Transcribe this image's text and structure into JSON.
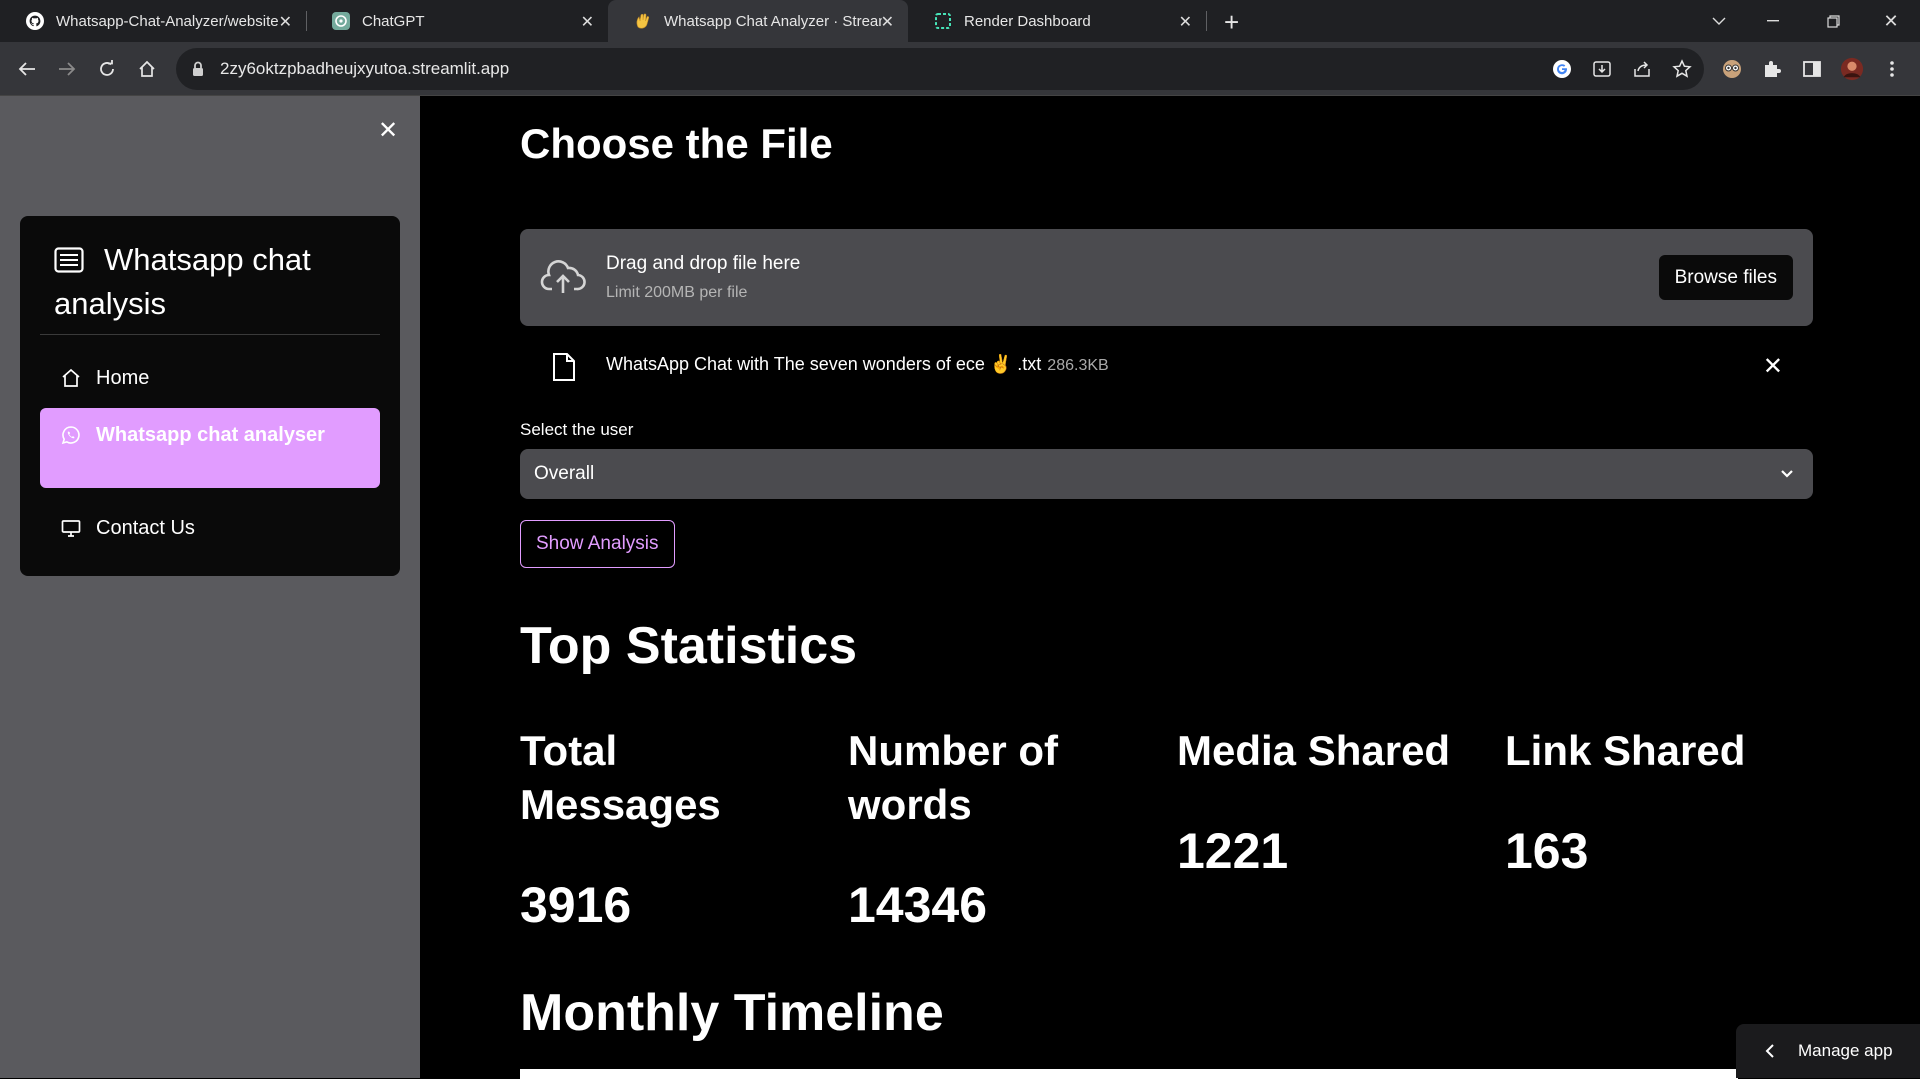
{
  "browser": {
    "tabs": [
      {
        "title": "Whatsapp-Chat-Analyzer/website",
        "icon": "github-icon"
      },
      {
        "title": "ChatGPT",
        "icon": "chatgpt-icon"
      },
      {
        "title": "Whatsapp Chat Analyzer · Stream",
        "icon": "waving-hand-icon"
      },
      {
        "title": "Render Dashboard",
        "icon": "render-icon"
      }
    ],
    "url": "2zy6oktzpbadheujxyutoa.streamlit.app"
  },
  "sidebar": {
    "menu_title": "Whatsapp chat analysis",
    "items": [
      {
        "label": "Home",
        "icon": "home-icon"
      },
      {
        "label": "Whatsapp chat analyser",
        "icon": "whatsapp-icon",
        "selected": true
      },
      {
        "label": "Contact Us",
        "icon": "display-icon"
      }
    ]
  },
  "main": {
    "upload_heading": "Choose the File",
    "dropzone": {
      "title": "Drag and drop file here",
      "limit": "Limit 200MB per file",
      "browse_label": "Browse files"
    },
    "uploaded_file": {
      "name": "WhatsApp Chat with The seven wonders of ece ✌️ .txt",
      "size": "286.3KB"
    },
    "select_user": {
      "label": "Select the user",
      "value": "Overall"
    },
    "show_analysis_label": "Show Analysis",
    "top_statistics": {
      "heading": "Top Statistics",
      "stats": [
        {
          "label": "Total Messages",
          "value": "3916"
        },
        {
          "label": "Number of words",
          "value": "14346"
        },
        {
          "label": "Media Shared",
          "value": "1221"
        },
        {
          "label": "Link Shared",
          "value": "163"
        }
      ]
    },
    "monthly_heading": "Monthly Timeline"
  },
  "manage_app_label": "Manage app",
  "colors": {
    "accent": "#e19cff",
    "sidebar_bg": "#5a5a5e",
    "widget_bg": "#4b4b4f",
    "main_bg": "#000000"
  }
}
